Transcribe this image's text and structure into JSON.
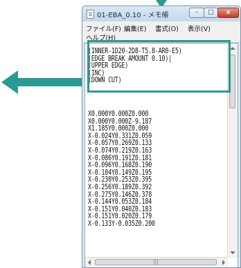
{
  "window": {
    "title": "01-EBA_0.10 - メモ帳",
    "controls": {
      "minimize": "–",
      "maximize": "□",
      "close": "x"
    }
  },
  "menu": {
    "items": [
      "ファイル(F)",
      "編集(E)",
      "書式(O)",
      "表示(V)",
      "ヘルプ(H)"
    ]
  },
  "editor": {
    "header_lines": [
      "(INNER-1D20-2D8-T5.8-AR0-E5)",
      "(EDGE BREAK AMOUNT 0.10)|",
      "(UPPER EDGE)",
      "(INC)",
      "(DOWN CUT)"
    ],
    "code_lines": [
      "X0.000Y0.000Z0.000",
      "X0.000Y0.000Z-9.187",
      "X1.185Y0.000Z0.000",
      "X-0.024Y0.331Z0.059",
      "X-0.057Y0.269Z0.133",
      "X-0.074Y0.219Z0.163",
      "X-0.086Y0.191Z0.181",
      "X-0.096Y0.168Z0.190",
      "X-0.104Y0.149Z0.195",
      "X-0.230Y0.253Z0.395",
      "X-0.256Y0.189Z0.392",
      "X-0.275Y0.146Z0.378",
      "X-0.144Y0.053Z0.184",
      "X-0.151Y0.040Z0.183",
      "X-0.151Y0.020Z0.179",
      "X-0.133Y-0.035Z0.200"
    ]
  },
  "scrollbar": {
    "h_thumb_grip": "|||"
  },
  "colors": {
    "annotation": "#2a9a92",
    "close_button": "#c23b22"
  },
  "icons": {
    "annotation_arrow_left": "arrow-left-icon",
    "annotation_arrow_down": "arrow-down-icon",
    "app": "notepad-icon"
  }
}
